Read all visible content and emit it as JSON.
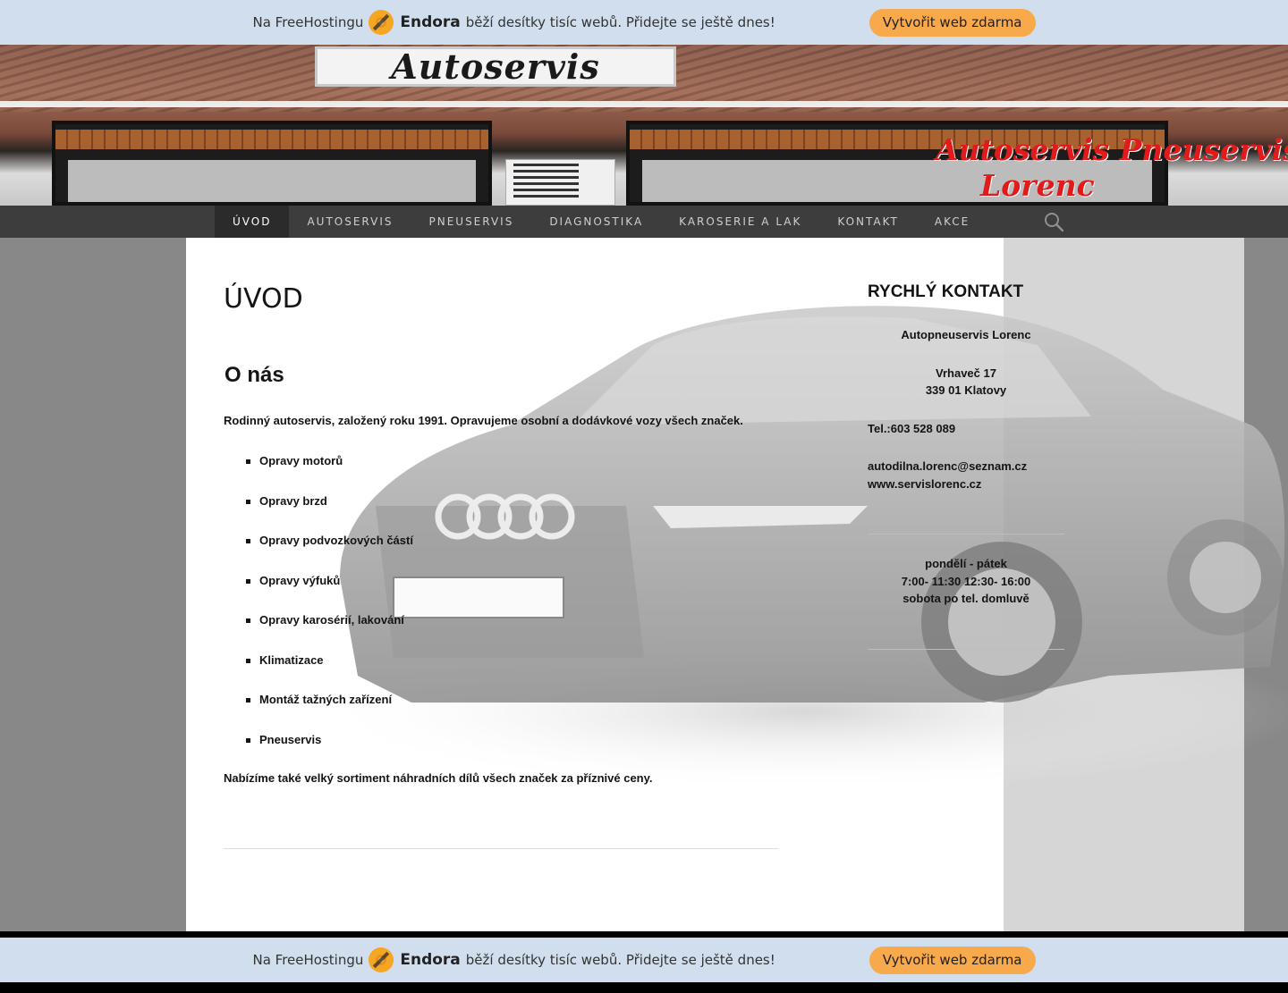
{
  "promo": {
    "text_before": "Na FreeHostingu",
    "brand": "Endora",
    "text_after": "běží desítky tisíc webů. Přidejte se ještě dnes!",
    "button": "Vytvořit web zdarma"
  },
  "banner": {
    "sign": "Autoservis",
    "title_line1": "Autoservis Pneuservis",
    "title_line2": "Lorenc"
  },
  "nav": {
    "items": [
      {
        "label": "ÚVOD"
      },
      {
        "label": "AUTOSERVIS"
      },
      {
        "label": "PNEUSERVIS"
      },
      {
        "label": "DIAGNOSTIKA"
      },
      {
        "label": "KAROSERIE A LAK"
      },
      {
        "label": "KONTAKT"
      },
      {
        "label": "AKCE"
      }
    ],
    "search_icon": "search-icon"
  },
  "main": {
    "title": "ÚVOD",
    "heading": "O nás",
    "intro": "Rodinný autoservis, založený roku 1991. Opravujeme osobní a dodávkové vozy všech značek.",
    "services": [
      "Opravy motorů",
      "Opravy brzd",
      "Opravy podvozkových částí",
      "Opravy výfuků",
      "Opravy karosérií, lakování",
      "Klimatizace",
      "Montáž tažných zařízení",
      "Pneuservis"
    ],
    "outro": "Nabízíme také velký sortiment náhradních dílů všech značek za příznivé ceny."
  },
  "sidebar": {
    "title": "RYCHLÝ KONTAKT",
    "company": "Autopneuservis Lorenc",
    "street": "Vrhaveč 17",
    "city": "339 01 Klatovy",
    "phone": "Tel.:603 528 089",
    "email": "autodilna.lorenc@seznam.cz",
    "web": "www.servislorenc.cz",
    "hours_days": "pondělí - pátek",
    "hours_time": "7:00- 11:30 12:30- 16:00",
    "hours_saturday": "sobota po tel. domluvě"
  }
}
